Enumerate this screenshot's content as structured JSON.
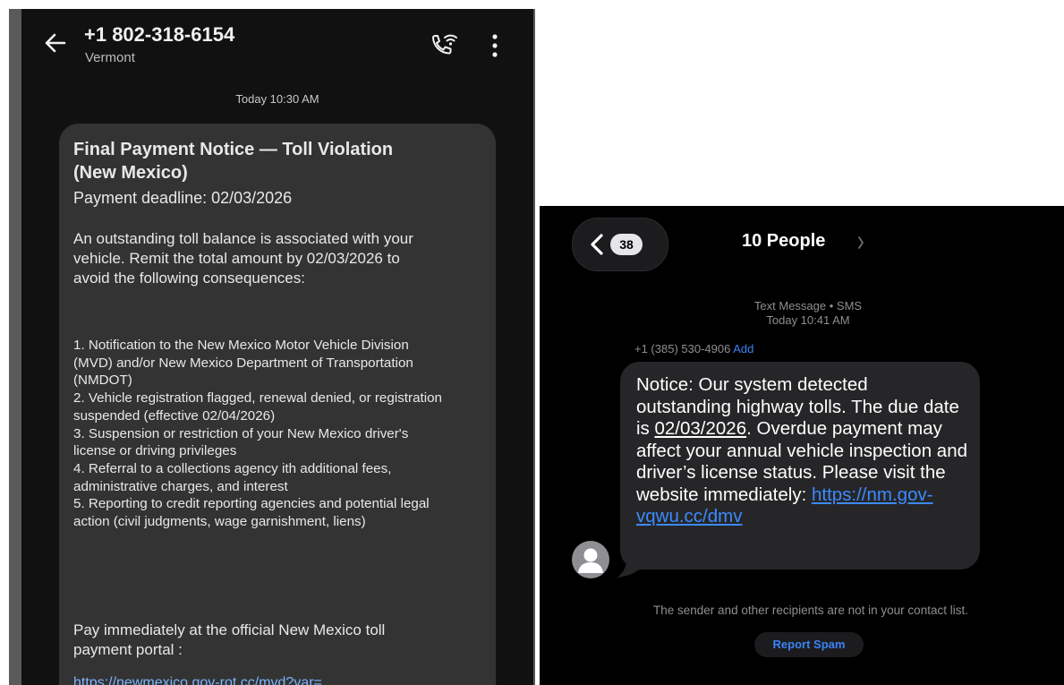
{
  "android": {
    "header": {
      "phone_number": "+1 802-318-6154",
      "location": "Vermont"
    },
    "timestamp": "Today 10:30 AM",
    "message": {
      "title": "Final Payment Notice — Toll Violation (New Mexico)",
      "deadline": "Payment deadline: 02/03/2026",
      "intro": "An outstanding toll balance is associated with your vehicle. Remit the total amount by 02/03/2026 to avoid the following consequences:",
      "consequences": [
        "1. Notification to the New Mexico Motor Vehicle Division (MVD) and/or New Mexico Department of Transportation (NMDOT)",
        "2. Vehicle registration flagged, renewal denied, or registration suspended (effective 02/04/2026)",
        "3. Suspension or restriction of your New Mexico driver's license or driving privileges",
        "4. Referral to a collections agency ith additional fees, administrative charges, and interest",
        "5. Reporting to credit reporting agencies and potential legal action (civil judgments, wage garnishment, liens)"
      ],
      "pay_prompt": "Pay immediately at the official New Mexico toll payment portal :",
      "link": "https://newmexico.gov-rot.cc/mvd?var="
    }
  },
  "ios": {
    "header": {
      "back_badge": "38",
      "title": "10 People"
    },
    "meta": {
      "type": "Text Message • SMS",
      "time": "Today 10:41 AM"
    },
    "sender": {
      "number": "+1 (385) 530-4906",
      "add_label": "Add"
    },
    "message": {
      "part1": "Notice: Our system detected outstanding highway tolls. The due date is ",
      "date": "02/03/2026",
      "part2": ". Overdue payment may affect your annual vehicle inspection and driver’s license status. Please visit the website immediately: ",
      "link": "https://nm.gov-vqwu.cc/dmv"
    },
    "notice": "The sender and other recipients are not in your contact list.",
    "report_spam_label": "Report Spam"
  }
}
